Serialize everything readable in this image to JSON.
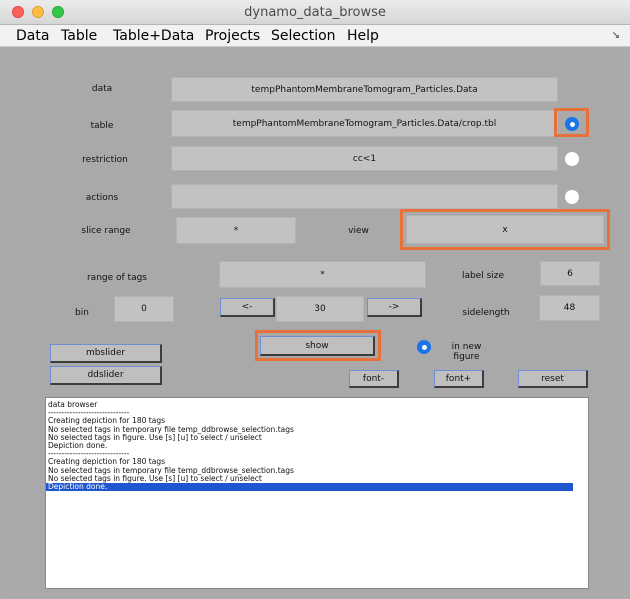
{
  "window": {
    "title": "dynamo_data_browse"
  },
  "menu": [
    "Data",
    "Table",
    "Table+Data",
    "Projects",
    "Selection",
    "Help"
  ],
  "form": {
    "data_label": "data",
    "data_value": "tempPhantomMembraneTomogram_Particles.Data",
    "table_label": "table",
    "table_value": "tempPhantomMembraneTomogram_Particles.Data/crop.tbl",
    "restriction_label": "restriction",
    "restriction_value": "cc<1",
    "actions_label": "actions",
    "actions_value": "",
    "slice_range_label": "slice range",
    "slice_range_value": "*",
    "view_label": "view",
    "view_value": "x",
    "range_of_tags_label": "range of tags",
    "range_of_tags_value": "*",
    "label_size_label": "label size",
    "label_size_value": "6",
    "bin_label": "bin",
    "bin_value": "0",
    "sidelength_label": "sidelength",
    "sidelength_value": "48",
    "step_value": "30"
  },
  "buttons": {
    "prev": "<-",
    "next": "->",
    "show": "show",
    "mbslider": "mbslider",
    "ddslider": "ddslider",
    "font_minus": "font-",
    "font_plus": "font+",
    "reset": "reset"
  },
  "options": {
    "in_new_figure": "in new figure"
  },
  "log": {
    "lines": [
      "data browser",
      "------------------------------",
      "Creating depiction for 180 tags",
      "No selected tags in temporary file temp_ddbrowse_selection.tags",
      "No selected tags in figure. Use [s] [u] to select / unselect",
      "Depiction done.",
      "------------------------------",
      "Creating depiction for 180 tags",
      "No selected tags in temporary file temp_ddbrowse_selection.tags",
      "No selected tags in figure. Use [s] [u] to select / unselect",
      "Depiction done."
    ],
    "selected_index": 10
  },
  "colors": {
    "highlight": "#e8713b",
    "selection": "#1e56cf",
    "radio_selected": "#1a73e8"
  }
}
